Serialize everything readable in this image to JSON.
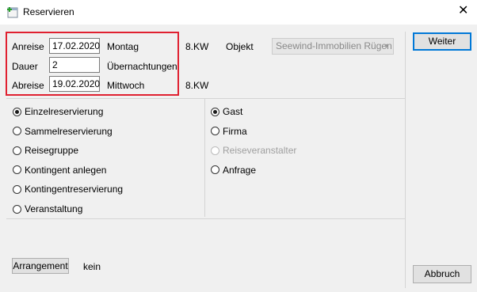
{
  "window": {
    "title": "Reservieren",
    "app_icon": "reservation-app-icon",
    "close_icon": "close-icon",
    "close_glyph": "✕"
  },
  "dates": {
    "arrival_label": "Anreise",
    "arrival_value": "17.02.2020",
    "arrival_day": "Montag",
    "arrival_week": "8.KW",
    "duration_label": "Dauer",
    "duration_value": "2",
    "duration_unit": "Übernachtungen",
    "departure_label": "Abreise",
    "departure_value": "19.02.2020",
    "departure_day": "Mittwoch",
    "departure_week": "8.KW"
  },
  "object": {
    "label": "Objekt",
    "selected": "Seewind-Immobilien Rügen"
  },
  "buttons": {
    "next": "Weiter",
    "cancel": "Abbruch",
    "arrangement": "Arrangement"
  },
  "arrangement_value": "kein",
  "reservation_types": [
    {
      "label": "Einzelreservierung",
      "checked": true
    },
    {
      "label": "Sammelreservierung",
      "checked": false
    },
    {
      "label": "Reisegruppe",
      "checked": false
    },
    {
      "label": "Kontingent anlegen",
      "checked": false
    },
    {
      "label": "Kontingentreservierung",
      "checked": false
    },
    {
      "label": "Veranstaltung",
      "checked": false
    }
  ],
  "guest_types": [
    {
      "label": "Gast",
      "checked": true,
      "disabled": false
    },
    {
      "label": "Firma",
      "checked": false,
      "disabled": false
    },
    {
      "label": "Reiseveranstalter",
      "checked": false,
      "disabled": true
    },
    {
      "label": "Anfrage",
      "checked": false,
      "disabled": false
    }
  ],
  "colors": {
    "highlight_box": "#e02030",
    "default_button_border": "#0078d7",
    "window_bg": "#f0f0f0"
  }
}
